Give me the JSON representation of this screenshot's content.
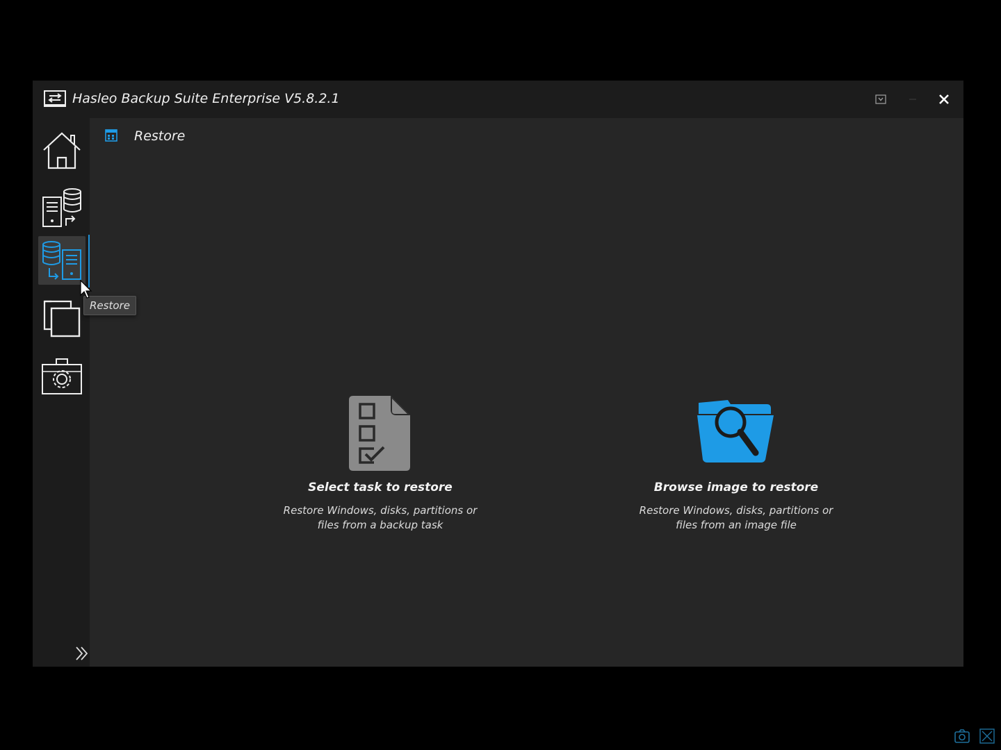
{
  "window": {
    "title": "Hasleo Backup Suite Enterprise V5.8.2.1"
  },
  "titlebar": {
    "buttons": [
      "dropdown-icon",
      "minimize-icon",
      "close-icon"
    ]
  },
  "sidebar": {
    "items": [
      {
        "name": "home",
        "icon": "home-icon",
        "active": false
      },
      {
        "name": "backup",
        "icon": "backup-icon",
        "active": false
      },
      {
        "name": "restore",
        "icon": "restore-icon",
        "active": true
      },
      {
        "name": "clone",
        "icon": "clone-icon",
        "active": false
      },
      {
        "name": "tools",
        "icon": "tools-icon",
        "active": false
      }
    ],
    "tooltip": "Restore"
  },
  "header": {
    "title": "Restore"
  },
  "options": [
    {
      "title": "Select task to restore",
      "description": "Restore Windows, disks, partitions or files from a backup task",
      "icon": "task-checklist-icon"
    },
    {
      "title": "Browse image to restore",
      "description": "Restore Windows, disks, partitions or files from an image file",
      "icon": "folder-search-icon"
    }
  ],
  "colors": {
    "accent": "#1e9be6",
    "background": "#262626",
    "sidebar": "#1c1c1c"
  }
}
